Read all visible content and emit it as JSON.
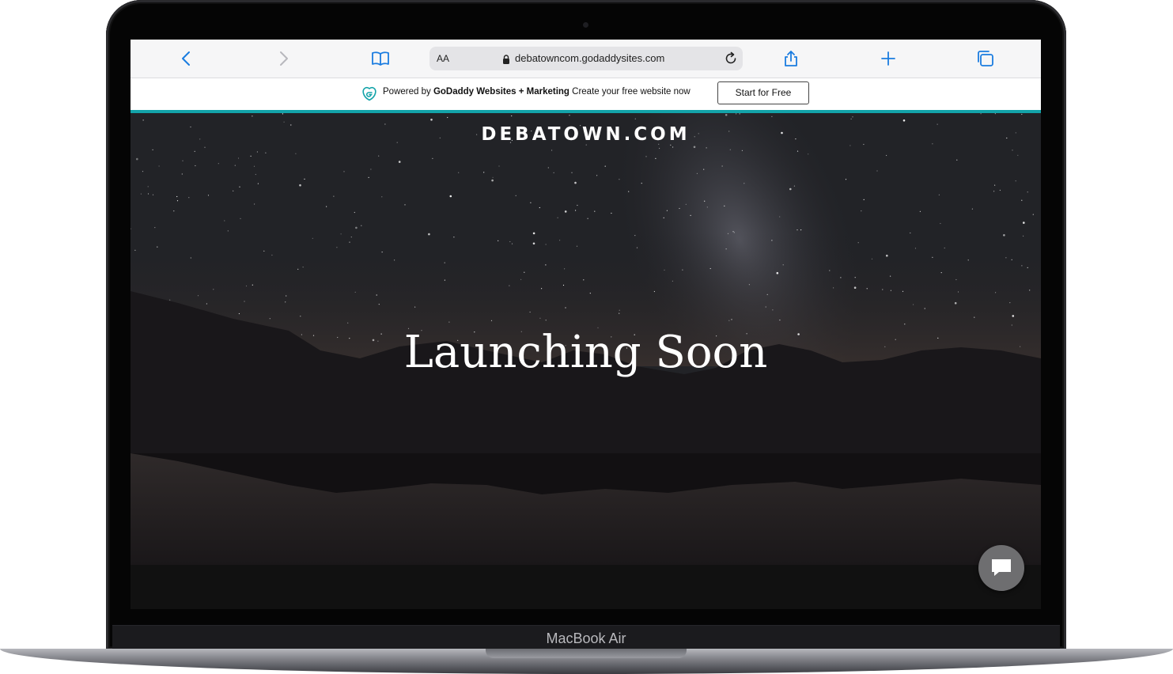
{
  "device": {
    "label": "MacBook Air"
  },
  "browser": {
    "url": "debatowncom.godaddysites.com",
    "reader_label": "AA",
    "icons": {
      "back": "chevron-left-icon",
      "forward": "chevron-right-icon",
      "bookmarks": "book-icon",
      "lock": "lock-icon",
      "reload": "reload-icon",
      "share": "share-icon",
      "new_tab": "plus-icon",
      "tabs": "tabs-icon"
    },
    "accent_color": "#1a7ce0"
  },
  "banner": {
    "powered_by": "Powered by ",
    "brand": "GoDaddy Websites + Marketing",
    "tagline": " Create your free website now",
    "cta_label": "Start for Free",
    "accent_color": "#13a3a9"
  },
  "site": {
    "title": "DEBATOWN.COM",
    "headline": "Launching Soon",
    "chat_icon": "chat-bubble-icon"
  }
}
